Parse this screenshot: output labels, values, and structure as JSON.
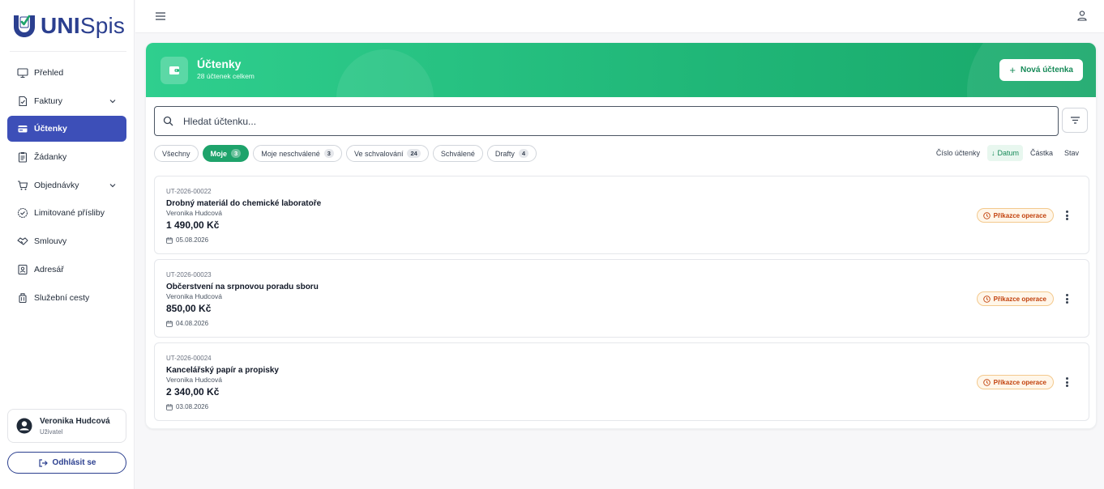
{
  "brand": {
    "logo_bold": "UNI",
    "logo_light": "Spis"
  },
  "colors": {
    "primary": "#3d4fb8",
    "brand_navy": "#2b3f8f",
    "accent_green": "#1ea36b",
    "status_orange": "#c2410c"
  },
  "sidebar": {
    "items": [
      {
        "label": "Přehled",
        "icon": "monitor-icon"
      },
      {
        "label": "Faktury",
        "icon": "invoice-icon",
        "has_children": true
      },
      {
        "label": "Účtenky",
        "icon": "receipt-icon",
        "active": true
      },
      {
        "label": "Žádanky",
        "icon": "clipboard-icon"
      },
      {
        "label": "Objednávky",
        "icon": "cart-icon",
        "has_children": true
      },
      {
        "label": "Limitované přísliby",
        "icon": "check-circle-icon"
      },
      {
        "label": "Smlouvy",
        "icon": "handshake-icon"
      },
      {
        "label": "Adresář",
        "icon": "contact-book-icon"
      },
      {
        "label": "Služební cesty",
        "icon": "luggage-icon"
      }
    ],
    "user": {
      "name": "Veronika Hudcová",
      "role": "Uživatel"
    },
    "logout_label": "Odhlásit se"
  },
  "hero": {
    "title": "Účtenky",
    "subtitle": "28 účtenek celkem",
    "new_button": "Nová účtenka"
  },
  "search": {
    "placeholder": "Hledat účtenku..."
  },
  "filters": [
    {
      "label": "Všechny",
      "count": ""
    },
    {
      "label": "Moje",
      "count": "3",
      "active": true
    },
    {
      "label": "Moje neschválené",
      "count": "3"
    },
    {
      "label": "Ve schvalování",
      "count": "24"
    },
    {
      "label": "Schválené",
      "count": ""
    },
    {
      "label": "Drafty",
      "count": "4"
    }
  ],
  "sort": {
    "options": [
      {
        "label": "Číslo účtenky"
      },
      {
        "label": "Datum",
        "active": true,
        "direction": "↓"
      },
      {
        "label": "Částka"
      },
      {
        "label": "Stav"
      }
    ]
  },
  "receipts": [
    {
      "number": "UT-2026-00022",
      "title": "Drobný materiál do chemické laboratoře",
      "author": "Veronika Hudcová",
      "amount": "1 490,00 Kč",
      "date": "05.08.2026",
      "status": "Příkazce operace"
    },
    {
      "number": "UT-2026-00023",
      "title": "Občerstvení na srpnovou poradu sboru",
      "author": "Veronika Hudcová",
      "amount": "850,00 Kč",
      "date": "04.08.2026",
      "status": "Příkazce operace"
    },
    {
      "number": "UT-2026-00024",
      "title": "Kancelářský papír a propisky",
      "author": "Veronika Hudcová",
      "amount": "2 340,00 Kč",
      "date": "03.08.2026",
      "status": "Příkazce operace"
    }
  ]
}
